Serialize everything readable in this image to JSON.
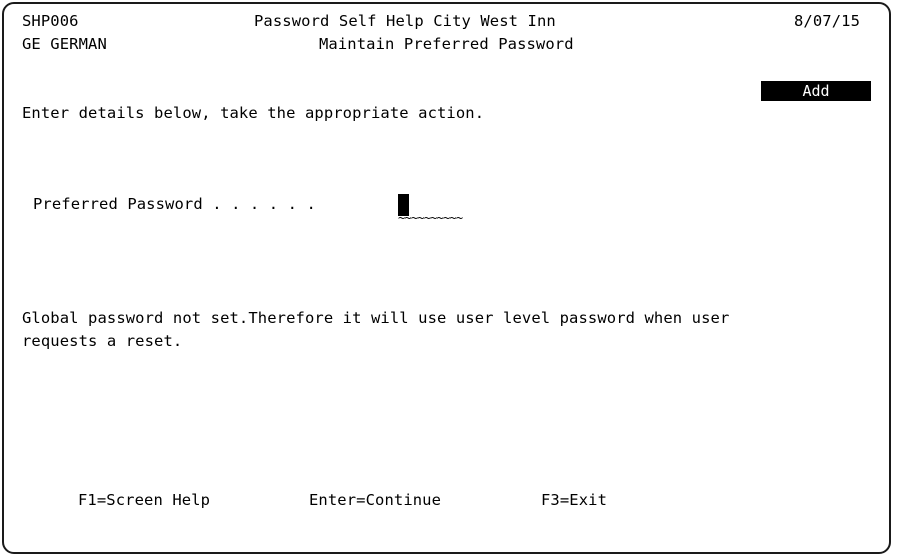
{
  "header": {
    "program_id": "SHP006",
    "user": "GE GERMAN",
    "title": "Password Self Help City West Inn",
    "subtitle": "Maintain Preferred Password",
    "date": "8/07/15"
  },
  "mode": "Add",
  "instruction": "Enter details below, take the appropriate action.",
  "form": {
    "preferred_password_label": "Preferred Password . . . . . .",
    "preferred_password_value": "",
    "field_marker": "~~~~~~~~~~"
  },
  "messages": {
    "line1": "Global password not set.Therefore it will use user level password when user",
    "line2": "requests a reset."
  },
  "function_keys": {
    "f1": "F1=Screen Help",
    "enter": "Enter=Continue",
    "f3": "F3=Exit"
  },
  "colors": {
    "text": "#000000",
    "background": "#ffffff",
    "badge_bg": "#000000",
    "badge_fg": "#ffffff"
  }
}
